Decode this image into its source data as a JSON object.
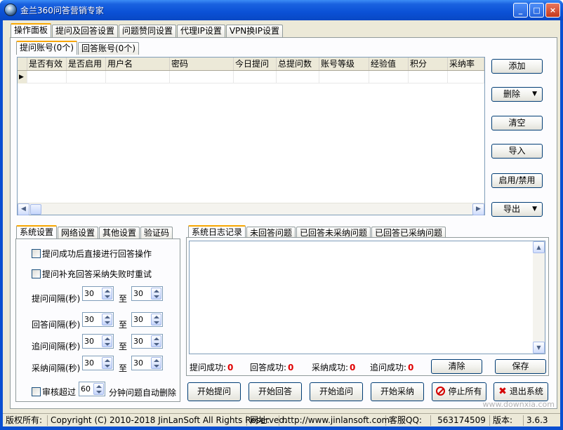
{
  "window": {
    "title": "金兰360问答营销专家",
    "controls": [
      "_",
      "□",
      "×"
    ]
  },
  "main_tabs": [
    "操作面板",
    "提问及回答设置",
    "问题赞同设置",
    "代理IP设置",
    "VPN换IP设置"
  ],
  "account_tabs": [
    "提问账号(0个)",
    "回答账号(0个)"
  ],
  "grid": {
    "columns": [
      "是否有效",
      "是否启用",
      "用户名",
      "密码",
      "今日提问",
      "总提问数",
      "账号等级",
      "经验值",
      "积分",
      "采纳率"
    ],
    "row_marker": "▶"
  },
  "side_buttons": {
    "add": "添加",
    "delete": "删除",
    "clear": "清空",
    "import": "导入",
    "enable_disable": "启用/禁用",
    "export": "导出"
  },
  "settings_tabs": [
    "系统设置",
    "网络设置",
    "其他设置",
    "验证码"
  ],
  "settings": {
    "check1": "提问成功后直接进行回答操作",
    "check2": "提问补充回答采纳失败时重试",
    "to": "至",
    "intervals": [
      {
        "label": "提问间隔(秒)",
        "from": "30",
        "to": "30"
      },
      {
        "label": "回答间隔(秒)",
        "from": "30",
        "to": "30"
      },
      {
        "label": "追问间隔(秒)",
        "from": "30",
        "to": "30"
      },
      {
        "label": "采纳间隔(秒)",
        "from": "30",
        "to": "30"
      }
    ],
    "audit_prefix": "审核超过",
    "audit_value": "60",
    "audit_suffix": "分钟问题自动删除"
  },
  "log_tabs": [
    "系统日志记录",
    "未回答问题",
    "已回答未采纳问题",
    "已回答已采纳问题"
  ],
  "stats": [
    {
      "label": "提问成功:",
      "value": "0"
    },
    {
      "label": "回答成功:",
      "value": "0"
    },
    {
      "label": "采纳成功:",
      "value": "0"
    },
    {
      "label": "追问成功:",
      "value": "0"
    }
  ],
  "log_buttons": {
    "clear": "清除",
    "save": "保存"
  },
  "action_buttons": [
    "开始提问",
    "开始回答",
    "开始追问",
    "开始采纳",
    "停止所有",
    "退出系统"
  ],
  "statusbar": {
    "copyright_label": "版权所有:",
    "copyright": "Copyright (C) 2010-2018 JinLanSoft All Rights Reserved.",
    "url_label": "网址:",
    "url": "http://www.jinlansoft.com",
    "qq_label": "客服QQ:",
    "qq": "563174509",
    "version_label": "版本:",
    "version": "3.6.3"
  },
  "watermark": "www.downxia.com"
}
